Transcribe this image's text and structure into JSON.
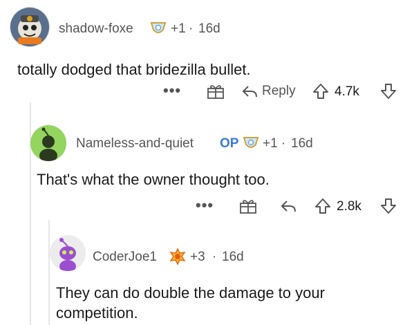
{
  "comments": [
    {
      "username": "shadow-foxe",
      "award_count": "+1",
      "separator": "·",
      "age": "16d",
      "body": "totally dodged that bridezilla bullet.",
      "reply_label": "Reply",
      "score": "4.7k"
    },
    {
      "username": "Nameless-and-quiet",
      "op_badge": "OP",
      "award_count": "+1",
      "separator": "·",
      "age": "16d",
      "body": "That's what the owner thought too.",
      "score": "2.8k"
    },
    {
      "username": "CoderJoe1",
      "award_count": "+3",
      "separator": "·",
      "age": "16d",
      "body": "They can do double the damage to your competition."
    }
  ],
  "more_label": "•••",
  "colors": {
    "text": "#1a1a1b",
    "meta": "#555555",
    "op": "#3a7bd5",
    "thread_line": "#e6e6e6"
  }
}
